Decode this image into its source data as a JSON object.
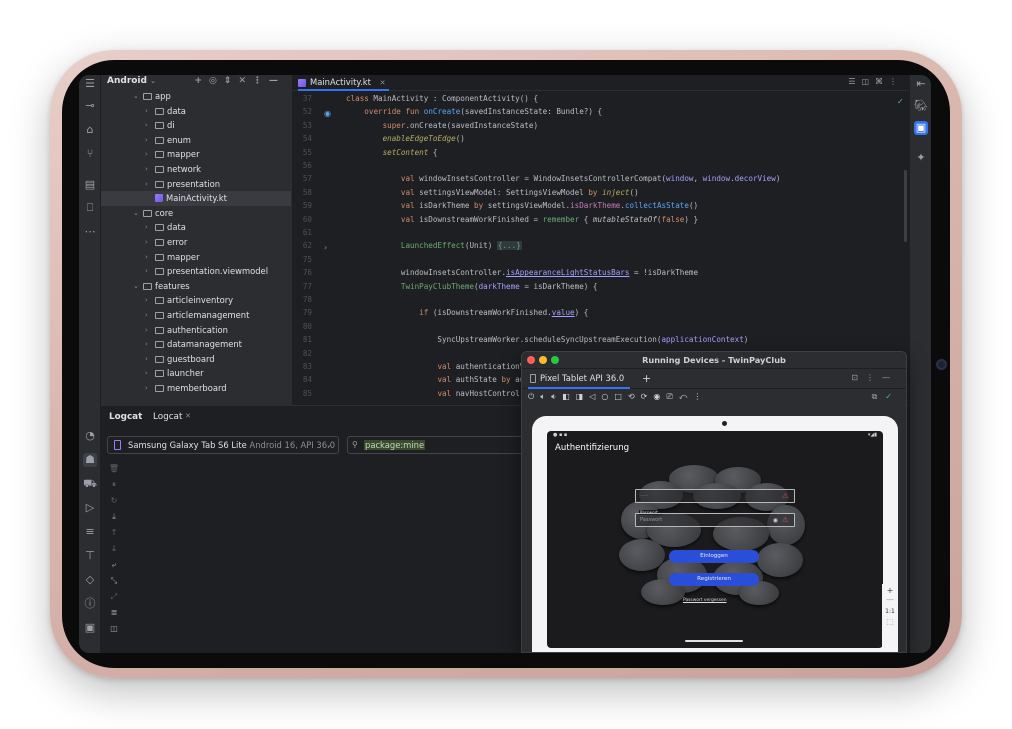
{
  "project": {
    "title": "Android",
    "tree": [
      {
        "label": "app",
        "level": 1,
        "open": true
      },
      {
        "label": "data",
        "level": 2
      },
      {
        "label": "di",
        "level": 2
      },
      {
        "label": "enum",
        "level": 2
      },
      {
        "label": "mapper",
        "level": 2
      },
      {
        "label": "network",
        "level": 2
      },
      {
        "label": "presentation",
        "level": 2
      },
      {
        "label": "MainActivity.kt",
        "level": 3,
        "file": true,
        "selected": true
      },
      {
        "label": "core",
        "level": 1,
        "open": true
      },
      {
        "label": "data",
        "level": 2
      },
      {
        "label": "error",
        "level": 2
      },
      {
        "label": "mapper",
        "level": 2
      },
      {
        "label": "presentation.viewmodel",
        "level": 2
      },
      {
        "label": "features",
        "level": 1,
        "open": true
      },
      {
        "label": "articleinventory",
        "level": 2
      },
      {
        "label": "articlemanagement",
        "level": 2
      },
      {
        "label": "authentication",
        "level": 2
      },
      {
        "label": "datamanagement",
        "level": 2
      },
      {
        "label": "guestboard",
        "level": 2
      },
      {
        "label": "launcher",
        "level": 2
      },
      {
        "label": "memberboard",
        "level": 2
      }
    ]
  },
  "editor": {
    "tab_label": "MainActivity.kt",
    "lines": [
      {
        "n": "37",
        "html": "<span class=\"kw\">class</span> MainActivity : ComponentActivity() {"
      },
      {
        "n": "52",
        "html": "    <span class=\"kw\">override fun</span> <span class=\"fn\">onCreate</span>(savedInstanceState: Bundle?) {"
      },
      {
        "n": "53",
        "html": "        <span class=\"kw\">super</span>.onCreate(savedInstanceState)"
      },
      {
        "n": "54",
        "html": "        <span class=\"ann\" style=\"font-style:italic\">enableEdgeToEdge</span>()"
      },
      {
        "n": "55",
        "html": "        <span class=\"ann\" style=\"font-style:italic\">setContent</span> {"
      },
      {
        "n": "56",
        "html": ""
      },
      {
        "n": "57",
        "html": "            <span class=\"kw\">val</span> windowInsetsController = WindowInsetsControllerCompat(<span class=\"prm\">window</span>, <span class=\"prm\">window</span>.<span class=\"prm\">decorView</span>)"
      },
      {
        "n": "58",
        "html": "            <span class=\"kw\">val</span> settingsViewModel: SettingsViewModel <span class=\"kw\">by</span> <span class=\"ann\" style=\"font-style:italic\">inject</span>()"
      },
      {
        "n": "59",
        "html": "            <span class=\"kw\">val</span> isDarkTheme <span class=\"kw\">by</span> settingsViewModel.<span class=\"prop\">isDarkTheme</span>.<span class=\"fn\">collectAsState</span>()"
      },
      {
        "n": "60",
        "html": "            <span class=\"kw\">val</span> isDownstreamWorkFinished = <span class=\"str\">remember</span> { <span class=\"it\" style=\"color:#bcbec4\">mutableStateOf</span>(<span class=\"kw\">false</span>) }"
      },
      {
        "n": "61",
        "html": ""
      },
      {
        "n": "62",
        "html": "            <span class=\"str\">LaunchedEffect</span>(Unit) <span class=\"fold\">{...}</span>"
      },
      {
        "n": "75",
        "html": ""
      },
      {
        "n": "76",
        "html": "            windowInsetsController.<span class=\"prm\" style=\"text-decoration:underline\">isAppearanceLightStatusBars</span> = !isDarkTheme"
      },
      {
        "n": "77",
        "html": "            <span class=\"str\">TwinPayClubTheme</span>(<span class=\"prm\">darkTheme</span> = isDarkTheme) {"
      },
      {
        "n": "78",
        "html": ""
      },
      {
        "n": "79",
        "html": "                <span class=\"kw\">if</span> (isDownstreamWorkFinished.<span class=\"prm\" style=\"text-decoration:underline\">value</span>) {"
      },
      {
        "n": "80",
        "html": ""
      },
      {
        "n": "81",
        "html": "                    SyncUpstreamWorker.scheduleSyncUpstreamExecution(<span class=\"prm\">applicationContext</span>)"
      },
      {
        "n": "82",
        "html": ""
      },
      {
        "n": "83",
        "html": "                    <span class=\"kw\">val</span> authenticationV"
      },
      {
        "n": "84",
        "html": "                    <span class=\"kw\">val</span> authState <span class=\"kw\">by</span> au"
      },
      {
        "n": "85",
        "html": "                    <span class=\"kw\">val</span> navHostControl"
      }
    ]
  },
  "logcat": {
    "tab_main": "Logcat",
    "tab_sub": "Logcat",
    "device_name": "Samsung Galaxy Tab S6 Lite",
    "device_detail": "Android 16, API 36.0",
    "filter": "package:mine"
  },
  "running_devices": {
    "title": "Running Devices - TwinPayClub",
    "tab_label": "Pixel Tablet API 36.0",
    "app": {
      "screen_title": "Authentifizierung",
      "field_label_password": "Passwort",
      "login_button": "Einloggen",
      "register_button": "Registrieren",
      "forgot_link": "Passwort vergessen",
      "zoom": "1:1"
    }
  },
  "colors": {
    "accent": "#3574f0",
    "button": "#2b4ed8",
    "error": "#e15050",
    "success": "#5fb865"
  }
}
